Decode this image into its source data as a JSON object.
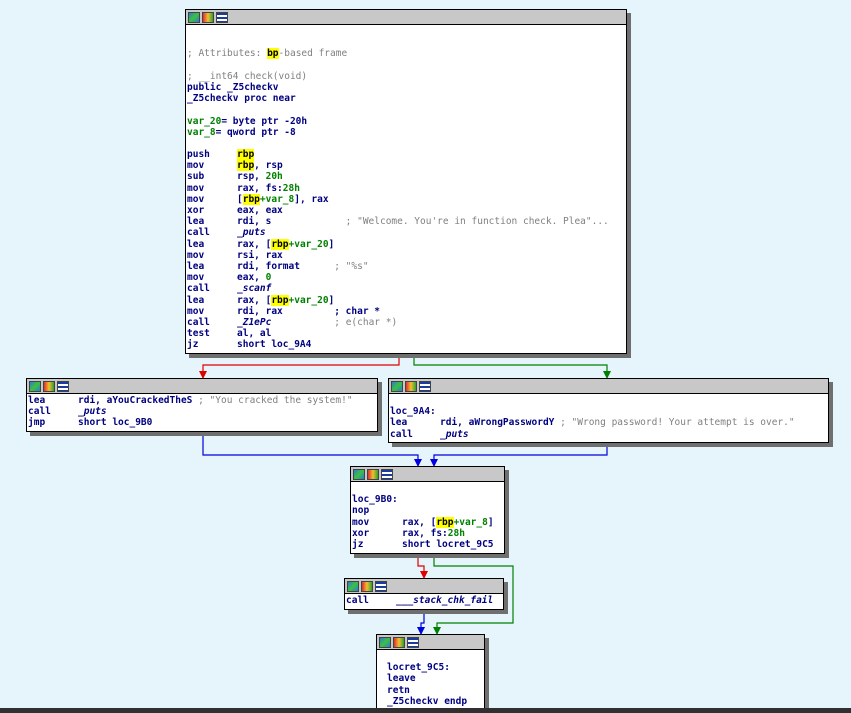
{
  "node_main": {
    "lines": [
      {
        "t": "blank"
      },
      {
        "t": "blank"
      },
      {
        "t": "comment_attr",
        "pre": "; Attributes: ",
        "hl": "bp",
        "post": "-based frame"
      },
      {
        "t": "blank"
      },
      {
        "t": "comment",
        "text": "; __int64 check(void)"
      },
      {
        "t": "plain",
        "text": "public _Z5checkv"
      },
      {
        "t": "plain",
        "text": "_Z5checkv proc near"
      },
      {
        "t": "blank"
      },
      {
        "t": "var",
        "name": "var_20",
        "rest": "= byte ptr -20h"
      },
      {
        "t": "var",
        "name": "var_8",
        "rest": "= qword ptr -8"
      },
      {
        "t": "blank"
      },
      {
        "t": "ins",
        "mn": "push",
        "parts": [
          {
            "c": "hl",
            "v": "rbp"
          }
        ]
      },
      {
        "t": "ins",
        "mn": "mov",
        "parts": [
          {
            "c": "hl",
            "v": "rbp"
          },
          {
            "c": "reg",
            "v": ", rsp"
          }
        ]
      },
      {
        "t": "ins",
        "mn": "sub",
        "parts": [
          {
            "c": "reg",
            "v": "rsp, "
          },
          {
            "c": "num",
            "v": "20h"
          }
        ]
      },
      {
        "t": "ins",
        "mn": "mov",
        "parts": [
          {
            "c": "reg",
            "v": "rax, fs:"
          },
          {
            "c": "num",
            "v": "28h"
          }
        ]
      },
      {
        "t": "ins",
        "mn": "mov",
        "parts": [
          {
            "c": "reg",
            "v": "["
          },
          {
            "c": "hl",
            "v": "rbp"
          },
          {
            "c": "var",
            "v": "+var_8"
          },
          {
            "c": "reg",
            "v": "], rax"
          }
        ]
      },
      {
        "t": "ins",
        "mn": "xor",
        "parts": [
          {
            "c": "reg",
            "v": "eax, eax"
          }
        ]
      },
      {
        "t": "ins",
        "mn": "lea",
        "parts": [
          {
            "c": "reg",
            "v": "rdi, s             "
          },
          {
            "c": "cmt",
            "v": "; \"Welcome. You're in function check. Plea\"..."
          }
        ]
      },
      {
        "t": "ins",
        "mn": "call",
        "parts": [
          {
            "c": "fn",
            "v": "_puts"
          }
        ]
      },
      {
        "t": "ins",
        "mn": "lea",
        "parts": [
          {
            "c": "reg",
            "v": "rax, ["
          },
          {
            "c": "hl",
            "v": "rbp"
          },
          {
            "c": "var",
            "v": "+var_20"
          },
          {
            "c": "reg",
            "v": "]"
          }
        ]
      },
      {
        "t": "ins",
        "mn": "mov",
        "parts": [
          {
            "c": "reg",
            "v": "rsi, rax"
          }
        ]
      },
      {
        "t": "ins",
        "mn": "lea",
        "parts": [
          {
            "c": "reg",
            "v": "rdi, format      "
          },
          {
            "c": "cmt",
            "v": "; \"%s\""
          }
        ]
      },
      {
        "t": "ins",
        "mn": "mov",
        "parts": [
          {
            "c": "reg",
            "v": "eax, "
          },
          {
            "c": "num",
            "v": "0"
          }
        ]
      },
      {
        "t": "ins",
        "mn": "call",
        "parts": [
          {
            "c": "fn",
            "v": "_scanf"
          }
        ]
      },
      {
        "t": "ins",
        "mn": "lea",
        "parts": [
          {
            "c": "reg",
            "v": "rax, ["
          },
          {
            "c": "hl",
            "v": "rbp"
          },
          {
            "c": "var",
            "v": "+var_20"
          },
          {
            "c": "reg",
            "v": "]"
          }
        ]
      },
      {
        "t": "ins",
        "mn": "mov",
        "parts": [
          {
            "c": "reg",
            "v": "rdi, rax         "
          },
          {
            "c": "kw",
            "v": "; char *"
          }
        ]
      },
      {
        "t": "ins",
        "mn": "call",
        "parts": [
          {
            "c": "fn",
            "v": "_Z1ePc"
          },
          {
            "c": "reg",
            "v": "           "
          },
          {
            "c": "cmt",
            "v": "; e(char *)"
          }
        ]
      },
      {
        "t": "ins",
        "mn": "test",
        "parts": [
          {
            "c": "reg",
            "v": "al, al"
          }
        ]
      },
      {
        "t": "ins",
        "mn": "jz",
        "parts": [
          {
            "c": "reg",
            "v": "short loc_9A4"
          }
        ]
      }
    ]
  },
  "node_cracked": {
    "lines": [
      {
        "t": "ins",
        "mn": "lea",
        "parts": [
          {
            "c": "reg",
            "v": "rdi, aYouCrackedTheS "
          },
          {
            "c": "cmt",
            "v": "; \"You cracked the system!\""
          }
        ]
      },
      {
        "t": "ins",
        "mn": "call",
        "parts": [
          {
            "c": "fn",
            "v": "_puts"
          }
        ]
      },
      {
        "t": "ins",
        "mn": "jmp",
        "parts": [
          {
            "c": "reg",
            "v": "short loc_9B0"
          }
        ]
      }
    ]
  },
  "node_wrong": {
    "lines": [
      {
        "t": "blank"
      },
      {
        "t": "plain",
        "text": "loc_9A4:"
      },
      {
        "t": "ins",
        "mn": "lea",
        "parts": [
          {
            "c": "reg",
            "v": "rdi, aWrongPasswordY "
          },
          {
            "c": "cmt",
            "v": "; \"Wrong password! Your attempt is over.\""
          }
        ]
      },
      {
        "t": "ins",
        "mn": "call",
        "parts": [
          {
            "c": "fn",
            "v": "_puts"
          }
        ]
      }
    ]
  },
  "node_9b0": {
    "lines": [
      {
        "t": "blank"
      },
      {
        "t": "plain",
        "text": "loc_9B0:"
      },
      {
        "t": "ins",
        "mn": "nop",
        "parts": []
      },
      {
        "t": "ins",
        "mn": "mov",
        "parts": [
          {
            "c": "reg",
            "v": "rax, ["
          },
          {
            "c": "hl",
            "v": "rbp"
          },
          {
            "c": "var",
            "v": "+var_8"
          },
          {
            "c": "reg",
            "v": "]"
          }
        ]
      },
      {
        "t": "ins",
        "mn": "xor",
        "parts": [
          {
            "c": "reg",
            "v": "rax, fs:"
          },
          {
            "c": "num",
            "v": "28h"
          }
        ]
      },
      {
        "t": "ins",
        "mn": "jz",
        "parts": [
          {
            "c": "reg",
            "v": "short locret_9C5"
          }
        ]
      }
    ]
  },
  "node_chk": {
    "lines": [
      {
        "t": "ins",
        "mn": "call",
        "parts": [
          {
            "c": "fn",
            "v": "___stack_chk_fail"
          }
        ]
      }
    ]
  },
  "node_ret": {
    "lines": [
      {
        "t": "blank"
      },
      {
        "t": "plain",
        "text": "locret_9C5:"
      },
      {
        "t": "ins",
        "mn": "leave",
        "parts": []
      },
      {
        "t": "ins",
        "mn": "retn",
        "parts": []
      },
      {
        "t": "plain",
        "text": "_Z5checkv endp"
      }
    ]
  },
  "colors": {
    "true_edge": "#e00000",
    "false_edge": "#008000",
    "jump_edge": "#0000e0",
    "highlight": "#ffff00"
  },
  "icons": [
    "graph-overview-icon",
    "node-color-icon",
    "text-view-icon"
  ]
}
